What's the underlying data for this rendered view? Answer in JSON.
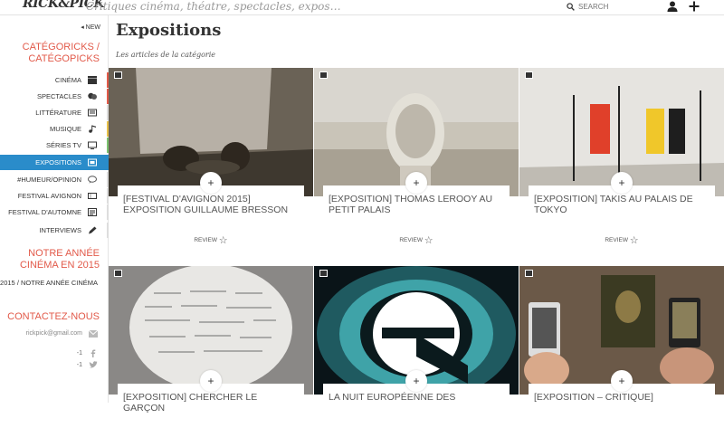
{
  "header": {
    "logo": "RICK&PICK",
    "tagline": "Critiques cinéma, théatre, spectacles, expos…",
    "search_placeholder": "SEARCH",
    "user_icon": "user-icon",
    "add_icon": "plus-icon"
  },
  "sidebar": {
    "new_label": "NEW",
    "categories_heading": "CATÉGORICKS / CATÉGOPICKS",
    "items": [
      {
        "label": "CINÉMA",
        "icon": "clapper-icon"
      },
      {
        "label": "SPECTACLES",
        "icon": "masks-icon"
      },
      {
        "label": "LITTÉRATURE",
        "icon": "book-icon"
      },
      {
        "label": "MUSIQUE",
        "icon": "music-note-icon"
      },
      {
        "label": "SÉRIES TV",
        "icon": "tv-icon"
      },
      {
        "label": "EXPOSITIONS",
        "icon": "frame-icon",
        "active": true
      },
      {
        "label": "#HUMEUR/OPINION",
        "icon": "speech-icon"
      },
      {
        "label": "FESTIVAL AVIGNON",
        "icon": "ticket-icon"
      },
      {
        "label": "FESTIVAL D'AUTOMNE",
        "icon": "newspaper-icon"
      },
      {
        "label": "INTERVIEWS",
        "icon": "pen-icon"
      }
    ],
    "year_heading": "NOTRE ANNÉE CINÉMA EN 2015",
    "year_link": "2015 / NOTRE ANNÉE CINÉMA",
    "contact_heading": "CONTACTEZ-NOUS",
    "email": "rickpick@gmail.com",
    "share_counts": [
      "-1",
      "-1"
    ]
  },
  "main": {
    "title": "Expositions",
    "subtitle": "Les articles de la catégorie",
    "cards": [
      {
        "title": "[FESTIVAL D'AVIGNON 2015] EXPOSITION GUILLAUME BRESSON",
        "review": "REVIEW"
      },
      {
        "title": "[EXPOSITION] THOMAS LEROOY AU PETIT PALAIS",
        "review": "REVIEW"
      },
      {
        "title": "[EXPOSITION] TAKIS AU PALAIS DE TOKYO",
        "review": "REVIEW"
      },
      {
        "title": "[EXPOSITION] CHERCHER LE GARÇON",
        "review": ""
      },
      {
        "title": "LA NUIT EUROPÉENNE DES",
        "review": ""
      },
      {
        "title": "[EXPOSITION – CRITIQUE]",
        "review": ""
      }
    ]
  },
  "colors": {
    "accent": "#e25a4a",
    "active": "#2a8cca"
  }
}
